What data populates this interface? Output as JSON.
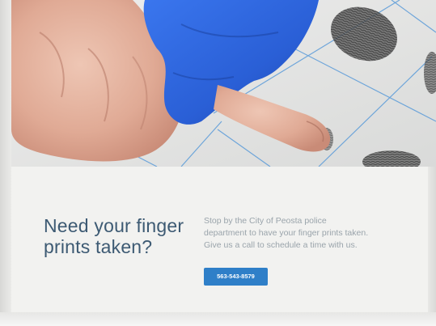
{
  "hero": {
    "image_description_icon": "fingerprint-photo"
  },
  "section": {
    "headline": "Need your finger prints taken?",
    "body": "Stop by the City of Peosta police department to have your finger prints taken. Give us a call to schedule a time with us.",
    "phone_button_label": "563-543-8579"
  },
  "colors": {
    "headline": "#3d5a73",
    "body_text": "#9aa4ab",
    "button_bg": "#2f7fc8",
    "button_text": "#ffffff",
    "glove": "#2a5fd6"
  }
}
